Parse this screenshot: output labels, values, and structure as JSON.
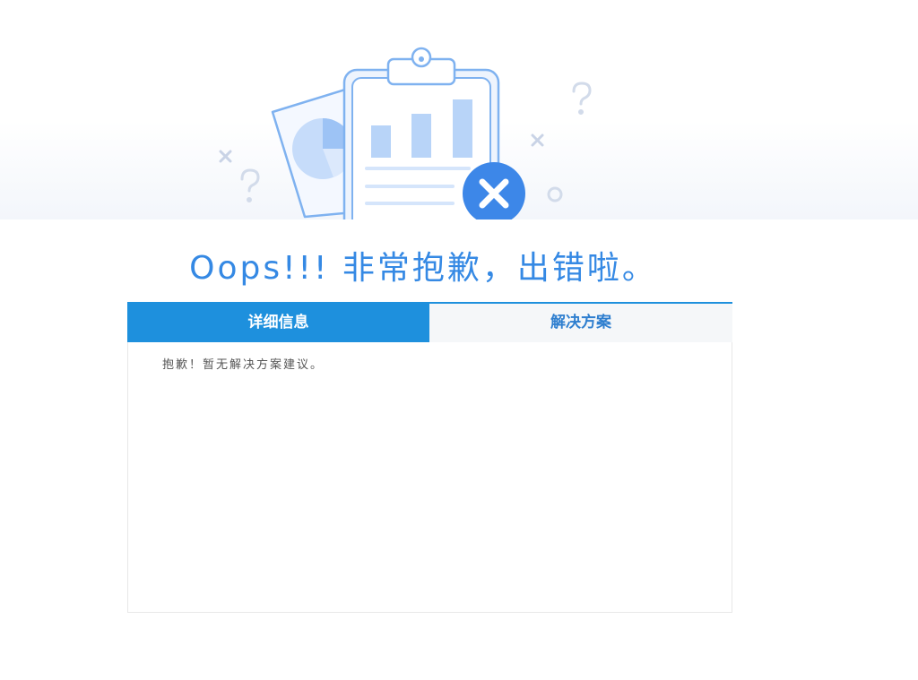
{
  "error_page": {
    "title": "Oops!!! 非常抱歉，出错啦。",
    "tabs": [
      {
        "label": "详细信息",
        "active": true
      },
      {
        "label": "解决方案",
        "active": false
      }
    ],
    "content_text": "抱歉！暂无解决方案建议。"
  },
  "colors": {
    "accent": "#1e90dd",
    "title": "#3589e4",
    "tab_inactive_bg": "#f5f7f9",
    "tab_inactive_text": "#2f7fcf"
  },
  "illustration": {
    "icons": [
      "clipboard-icon",
      "bar-chart-icon",
      "pie-chart-icon",
      "error-x-icon",
      "question-mark-icon",
      "cross-mark-icon"
    ]
  }
}
